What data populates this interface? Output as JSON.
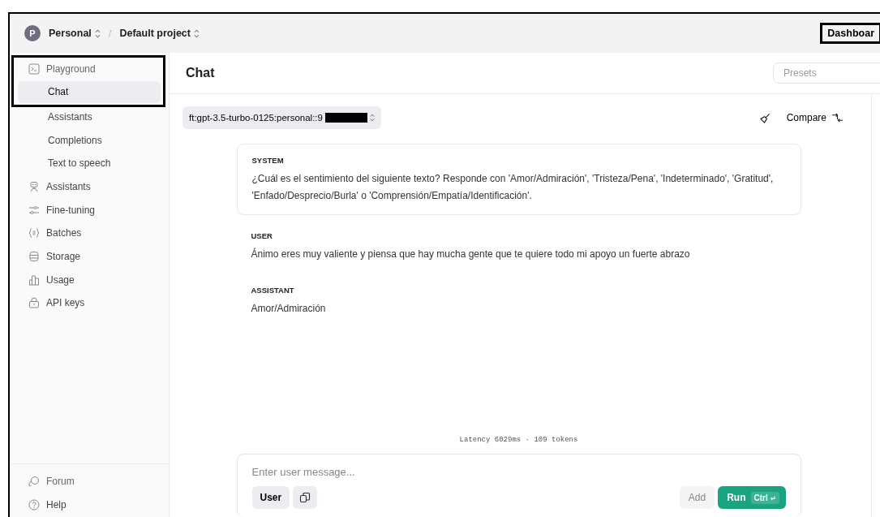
{
  "topbar": {
    "avatar": "P",
    "org": "Personal",
    "separator": "/",
    "project": "Default project",
    "dashboard": {
      "label": "Dashboar",
      "highlighted": true
    }
  },
  "sidebar": {
    "playground": {
      "label": "Playground",
      "highlighted": true
    },
    "items": [
      {
        "label": "Chat",
        "kind": "sub",
        "selected": true
      },
      {
        "label": "Assistants",
        "kind": "sub",
        "selected": false
      },
      {
        "label": "Completions",
        "kind": "sub",
        "selected": false
      },
      {
        "label": "Text to speech",
        "kind": "sub",
        "selected": false
      },
      {
        "label": "Assistants",
        "kind": "robot",
        "selected": false
      },
      {
        "label": "Fine-tuning",
        "kind": "tune",
        "selected": false
      },
      {
        "label": "Batches",
        "kind": "batch",
        "selected": false
      },
      {
        "label": "Storage",
        "kind": "storage",
        "selected": false
      },
      {
        "label": "Usage",
        "kind": "usage",
        "selected": false
      },
      {
        "label": "API keys",
        "kind": "lock",
        "selected": false
      }
    ],
    "footer": [
      {
        "label": "Forum",
        "kind": "forum"
      },
      {
        "label": "Help",
        "kind": "help"
      }
    ]
  },
  "header": {
    "title": "Chat",
    "presets_placeholder": "Presets"
  },
  "model": {
    "name": "ft:gpt-3.5-turbo-0125:personal::9",
    "redacted": true
  },
  "toolbar": {
    "compare": "Compare"
  },
  "messages": [
    {
      "role": "SYSTEM",
      "text": "¿Cuál es el sentimiento del siguiente texto? Responde con 'Amor/Admiración', 'Tristeza/Pena', 'Indeterminado', 'Gratitud', 'Enfado/Desprecio/Burla' o 'Comprensión/Empatía/Identificación'.",
      "boxed": true
    },
    {
      "role": "USER",
      "text": "Ánimo eres muy valiente y piensa que hay mucha gente que te quiere todo mi apoyo un fuerte abrazo",
      "boxed": false
    },
    {
      "role": "ASSISTANT",
      "text": "Amor/Admiración",
      "boxed": false
    }
  ],
  "stats": "Latency 6029ms · 109 tokens",
  "composer": {
    "placeholder": "Enter user message...",
    "role": "User",
    "add": "Add",
    "run": "Run",
    "shortcut": "Ctrl",
    "shortcut_icon": "↵"
  }
}
